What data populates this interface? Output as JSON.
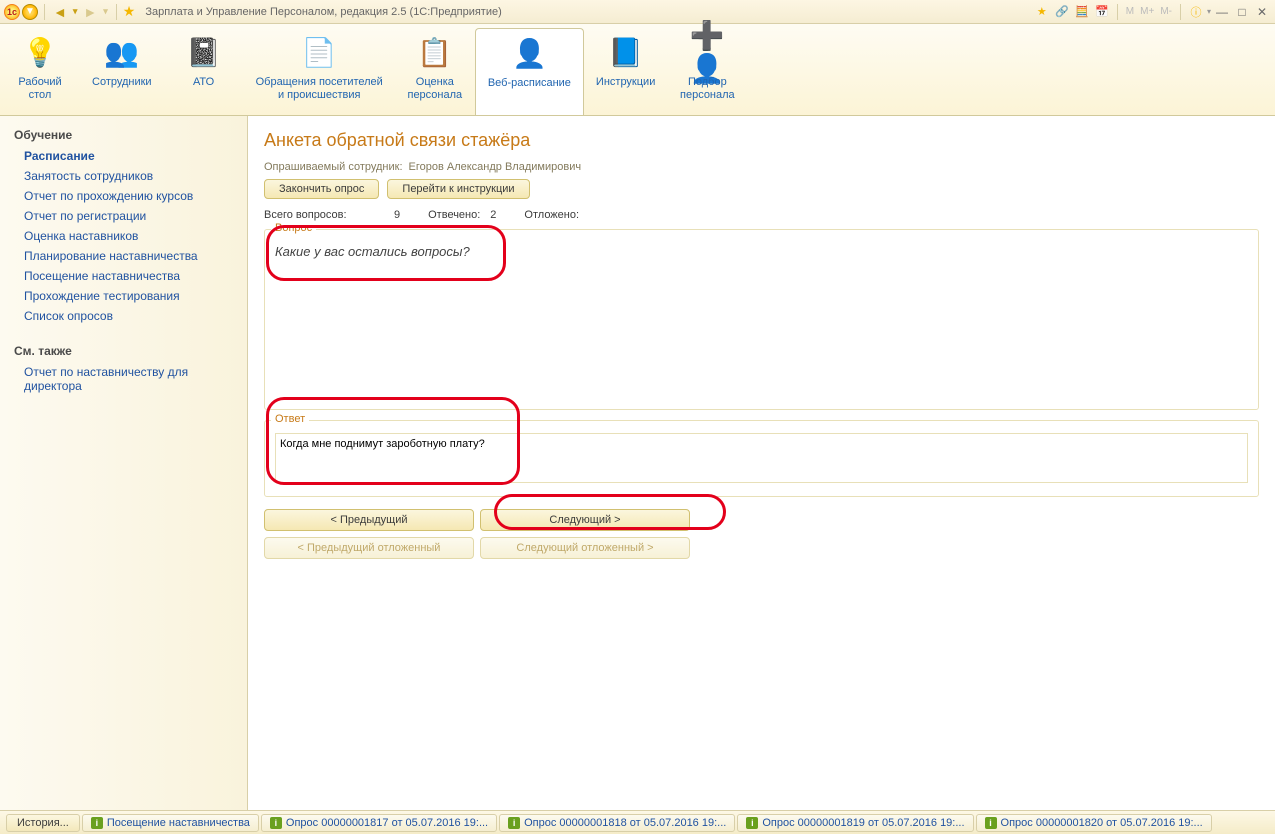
{
  "titlebar": {
    "title": "Зарплата и Управление Персоналом, редакция 2.5  (1С:Предприятие)",
    "m_buttons": [
      "M",
      "M+",
      "M-"
    ]
  },
  "toolbar": {
    "items": [
      {
        "label": "Рабочий\nстол",
        "icon": "💡"
      },
      {
        "label": "Сотрудники",
        "icon": "👥"
      },
      {
        "label": "АТО",
        "icon": "📓"
      },
      {
        "label": "Обращения посетителей\nи происшествия",
        "icon": "📄"
      },
      {
        "label": "Оценка\nперсонала",
        "icon": "📋"
      },
      {
        "label": "Веб-расписание",
        "icon": "👤"
      },
      {
        "label": "Инструкции",
        "icon": "📘"
      },
      {
        "label": "Подбор\nперсонала",
        "icon": "➕👤"
      }
    ],
    "active_index": 5
  },
  "sidebar": {
    "groups": [
      {
        "title": "Обучение",
        "items": [
          {
            "label": "Расписание",
            "active": true
          },
          {
            "label": "Занятость сотрудников"
          },
          {
            "label": "Отчет по прохождению курсов"
          },
          {
            "label": "Отчет по регистрации"
          },
          {
            "label": "Оценка наставников"
          },
          {
            "label": "Планирование наставничества"
          },
          {
            "label": "Посещение наставничества"
          },
          {
            "label": "Прохождение тестирования"
          },
          {
            "label": "Список опросов"
          }
        ]
      },
      {
        "title": "См. также",
        "items": [
          {
            "label": "Отчет по наставничеству для директора"
          }
        ]
      }
    ]
  },
  "page": {
    "title": "Анкета обратной связи стажёра",
    "employee_label": "Опрашиваемый сотрудник:",
    "employee_value": "Егоров Александр Владимирович",
    "btn_finish": "Закончить опрос",
    "btn_instructions": "Перейти к инструкции",
    "stats": {
      "total_label": "Всего вопросов:",
      "total_value": "9",
      "answered_label": "Отвечено:",
      "answered_value": "2",
      "deferred_label": "Отложено:",
      "deferred_value": ""
    },
    "question_legend": "Вопрос",
    "question_text": "Какие у вас остались вопросы?",
    "answer_legend": "Ответ",
    "answer_value": "Когда мне поднимут зароботную плату?",
    "nav": {
      "prev": "< Предыдущий",
      "next": "Следующий >",
      "prev_deferred": "< Предыдущий отложенный",
      "next_deferred": "Следующий отложенный >"
    }
  },
  "taskbar": {
    "history": "История...",
    "tabs": [
      "Посещение наставничества",
      "Опрос 00000001817 от 05.07.2016 19:...",
      "Опрос 00000001818 от 05.07.2016 19:...",
      "Опрос 00000001819 от 05.07.2016 19:...",
      "Опрос 00000001820 от 05.07.2016 19:..."
    ]
  }
}
